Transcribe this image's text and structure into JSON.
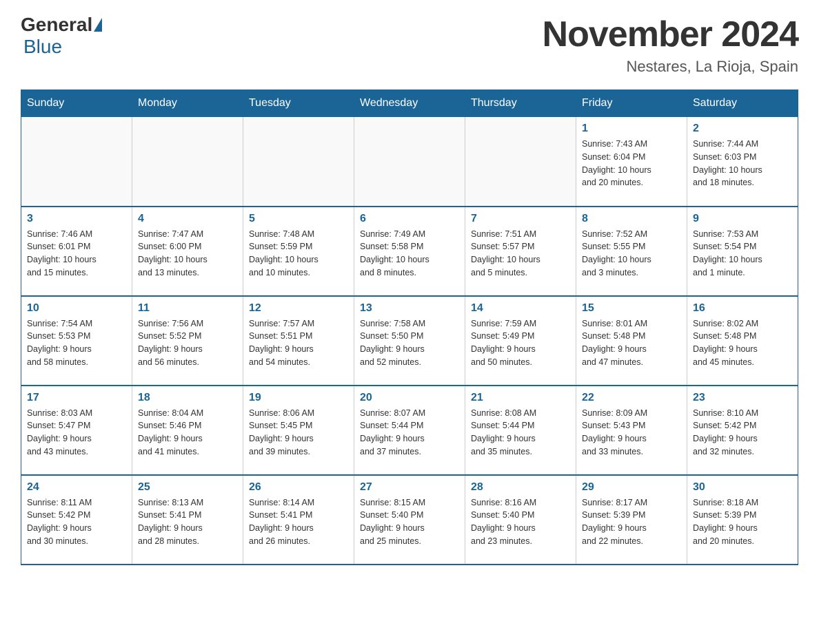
{
  "header": {
    "logo_general": "General",
    "logo_blue": "Blue",
    "month_title": "November 2024",
    "location": "Nestares, La Rioja, Spain"
  },
  "weekdays": [
    "Sunday",
    "Monday",
    "Tuesday",
    "Wednesday",
    "Thursday",
    "Friday",
    "Saturday"
  ],
  "weeks": [
    [
      {
        "day": "",
        "info": ""
      },
      {
        "day": "",
        "info": ""
      },
      {
        "day": "",
        "info": ""
      },
      {
        "day": "",
        "info": ""
      },
      {
        "day": "",
        "info": ""
      },
      {
        "day": "1",
        "info": "Sunrise: 7:43 AM\nSunset: 6:04 PM\nDaylight: 10 hours\nand 20 minutes."
      },
      {
        "day": "2",
        "info": "Sunrise: 7:44 AM\nSunset: 6:03 PM\nDaylight: 10 hours\nand 18 minutes."
      }
    ],
    [
      {
        "day": "3",
        "info": "Sunrise: 7:46 AM\nSunset: 6:01 PM\nDaylight: 10 hours\nand 15 minutes."
      },
      {
        "day": "4",
        "info": "Sunrise: 7:47 AM\nSunset: 6:00 PM\nDaylight: 10 hours\nand 13 minutes."
      },
      {
        "day": "5",
        "info": "Sunrise: 7:48 AM\nSunset: 5:59 PM\nDaylight: 10 hours\nand 10 minutes."
      },
      {
        "day": "6",
        "info": "Sunrise: 7:49 AM\nSunset: 5:58 PM\nDaylight: 10 hours\nand 8 minutes."
      },
      {
        "day": "7",
        "info": "Sunrise: 7:51 AM\nSunset: 5:57 PM\nDaylight: 10 hours\nand 5 minutes."
      },
      {
        "day": "8",
        "info": "Sunrise: 7:52 AM\nSunset: 5:55 PM\nDaylight: 10 hours\nand 3 minutes."
      },
      {
        "day": "9",
        "info": "Sunrise: 7:53 AM\nSunset: 5:54 PM\nDaylight: 10 hours\nand 1 minute."
      }
    ],
    [
      {
        "day": "10",
        "info": "Sunrise: 7:54 AM\nSunset: 5:53 PM\nDaylight: 9 hours\nand 58 minutes."
      },
      {
        "day": "11",
        "info": "Sunrise: 7:56 AM\nSunset: 5:52 PM\nDaylight: 9 hours\nand 56 minutes."
      },
      {
        "day": "12",
        "info": "Sunrise: 7:57 AM\nSunset: 5:51 PM\nDaylight: 9 hours\nand 54 minutes."
      },
      {
        "day": "13",
        "info": "Sunrise: 7:58 AM\nSunset: 5:50 PM\nDaylight: 9 hours\nand 52 minutes."
      },
      {
        "day": "14",
        "info": "Sunrise: 7:59 AM\nSunset: 5:49 PM\nDaylight: 9 hours\nand 50 minutes."
      },
      {
        "day": "15",
        "info": "Sunrise: 8:01 AM\nSunset: 5:48 PM\nDaylight: 9 hours\nand 47 minutes."
      },
      {
        "day": "16",
        "info": "Sunrise: 8:02 AM\nSunset: 5:48 PM\nDaylight: 9 hours\nand 45 minutes."
      }
    ],
    [
      {
        "day": "17",
        "info": "Sunrise: 8:03 AM\nSunset: 5:47 PM\nDaylight: 9 hours\nand 43 minutes."
      },
      {
        "day": "18",
        "info": "Sunrise: 8:04 AM\nSunset: 5:46 PM\nDaylight: 9 hours\nand 41 minutes."
      },
      {
        "day": "19",
        "info": "Sunrise: 8:06 AM\nSunset: 5:45 PM\nDaylight: 9 hours\nand 39 minutes."
      },
      {
        "day": "20",
        "info": "Sunrise: 8:07 AM\nSunset: 5:44 PM\nDaylight: 9 hours\nand 37 minutes."
      },
      {
        "day": "21",
        "info": "Sunrise: 8:08 AM\nSunset: 5:44 PM\nDaylight: 9 hours\nand 35 minutes."
      },
      {
        "day": "22",
        "info": "Sunrise: 8:09 AM\nSunset: 5:43 PM\nDaylight: 9 hours\nand 33 minutes."
      },
      {
        "day": "23",
        "info": "Sunrise: 8:10 AM\nSunset: 5:42 PM\nDaylight: 9 hours\nand 32 minutes."
      }
    ],
    [
      {
        "day": "24",
        "info": "Sunrise: 8:11 AM\nSunset: 5:42 PM\nDaylight: 9 hours\nand 30 minutes."
      },
      {
        "day": "25",
        "info": "Sunrise: 8:13 AM\nSunset: 5:41 PM\nDaylight: 9 hours\nand 28 minutes."
      },
      {
        "day": "26",
        "info": "Sunrise: 8:14 AM\nSunset: 5:41 PM\nDaylight: 9 hours\nand 26 minutes."
      },
      {
        "day": "27",
        "info": "Sunrise: 8:15 AM\nSunset: 5:40 PM\nDaylight: 9 hours\nand 25 minutes."
      },
      {
        "day": "28",
        "info": "Sunrise: 8:16 AM\nSunset: 5:40 PM\nDaylight: 9 hours\nand 23 minutes."
      },
      {
        "day": "29",
        "info": "Sunrise: 8:17 AM\nSunset: 5:39 PM\nDaylight: 9 hours\nand 22 minutes."
      },
      {
        "day": "30",
        "info": "Sunrise: 8:18 AM\nSunset: 5:39 PM\nDaylight: 9 hours\nand 20 minutes."
      }
    ]
  ]
}
